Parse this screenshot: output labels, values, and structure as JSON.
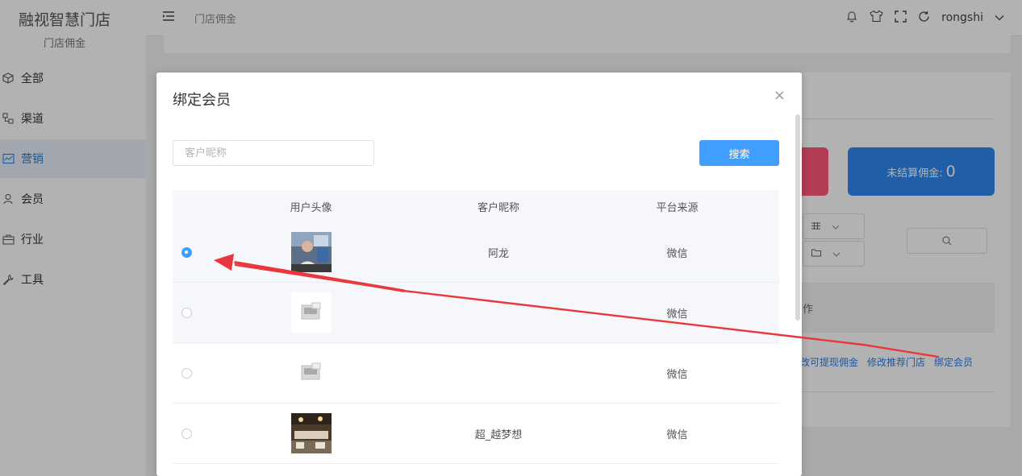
{
  "brand": {
    "title": "融视智慧门店",
    "subtitle": "门店佣金"
  },
  "sidebar": {
    "items": [
      {
        "label": "全部",
        "icon": "cube-icon"
      },
      {
        "label": "渠道",
        "icon": "channel-icon"
      },
      {
        "label": "营销",
        "icon": "chart-icon",
        "active": true
      },
      {
        "label": "会员",
        "icon": "user-icon"
      },
      {
        "label": "行业",
        "icon": "briefcase-icon"
      },
      {
        "label": "工具",
        "icon": "wrench-icon"
      }
    ]
  },
  "header": {
    "breadcrumb": "门店佣金",
    "user": "rongshi",
    "icons": [
      "bell-icon",
      "shirt-icon",
      "fullscreen-icon",
      "refresh-icon",
      "chevron-down-icon"
    ]
  },
  "background": {
    "stat_label": "未结算佣金:",
    "stat_value": "0",
    "table_header_partial": "作",
    "actions": [
      "改可提现佣金",
      "修改推荐门店",
      "绑定会员"
    ]
  },
  "modal": {
    "title": "绑定会员",
    "close_symbol": "×",
    "search_placeholder": "客户昵称",
    "search_button": "搜索",
    "columns": [
      "用户头像",
      "客户昵称",
      "平台来源"
    ],
    "rows": [
      {
        "avatar": "photo",
        "nickname": "阿龙",
        "platform": "微信",
        "selected": true
      },
      {
        "avatar": "placeholder",
        "nickname": "",
        "platform": "微信",
        "selected": false
      },
      {
        "avatar": "placeholder",
        "nickname": "",
        "platform": "微信",
        "selected": false
      },
      {
        "avatar": "restaurant",
        "nickname": "超_越梦想",
        "platform": "微信",
        "selected": false
      }
    ]
  },
  "colors": {
    "primary": "#409eff",
    "annotation": "#e8373d",
    "stat_red": "#ff5777",
    "stat_blue": "#2e89f0"
  }
}
